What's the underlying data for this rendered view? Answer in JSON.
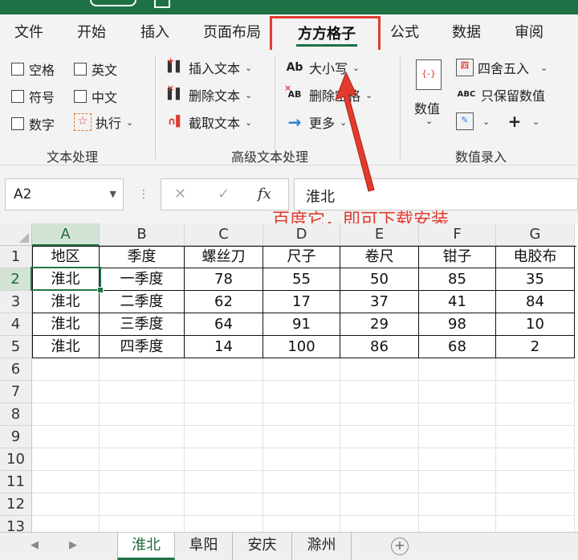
{
  "menu": {
    "items": [
      "文件",
      "开始",
      "插入",
      "页面布局",
      "方方格子",
      "公式",
      "数据",
      "审阅"
    ]
  },
  "ribbon": {
    "text_group": {
      "checkboxes": [
        "空格",
        "英文",
        "符号",
        "中文",
        "数字"
      ],
      "execute": "执行",
      "label": "文本处理"
    },
    "advanced_group": {
      "insert_text": "插入文本",
      "delete_text": "删除文本",
      "extract_text": "截取文本",
      "case": "大小写",
      "delete_space": "删除空格",
      "more": "更多",
      "label": "高级文本处理"
    },
    "value_group": {
      "value_btn": "数值",
      "round": "四舍五入",
      "keep_values": "只保留数值",
      "label": "数值录入"
    }
  },
  "formula_bar": {
    "name_box": "A2",
    "content": "淮北"
  },
  "promo_text": "百度它，即可下载安装",
  "sheet": {
    "columns": [
      "A",
      "B",
      "C",
      "D",
      "E",
      "F",
      "G"
    ],
    "rows": [
      "1",
      "2",
      "3",
      "4",
      "5",
      "6",
      "7",
      "8",
      "9",
      "10",
      "11",
      "12",
      "13"
    ],
    "data": [
      [
        "地区",
        "季度",
        "螺丝刀",
        "尺子",
        "卷尺",
        "钳子",
        "电胶布"
      ],
      [
        "淮北",
        "一季度",
        "78",
        "55",
        "50",
        "85",
        "35"
      ],
      [
        "淮北",
        "二季度",
        "62",
        "17",
        "37",
        "41",
        "84"
      ],
      [
        "淮北",
        "三季度",
        "64",
        "91",
        "29",
        "98",
        "10"
      ],
      [
        "淮北",
        "四季度",
        "14",
        "100",
        "86",
        "68",
        "2"
      ]
    ]
  },
  "sheet_tabs": [
    "淮北",
    "阜阳",
    "安庆",
    "滁州"
  ],
  "colors": {
    "accent": "#217346",
    "highlight": "#e03b2e"
  }
}
